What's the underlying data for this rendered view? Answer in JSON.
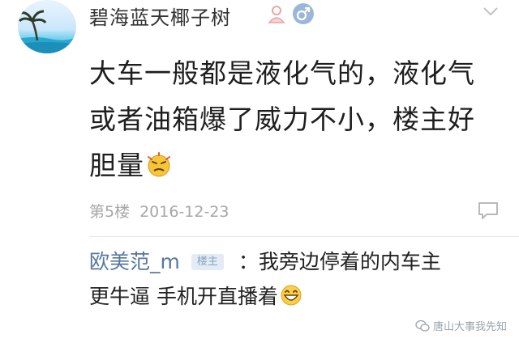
{
  "post": {
    "username": "碧海蓝天椰子树",
    "content_line1": "大车一般都是液化气的，液化气",
    "content_line2": "或者油箱爆了威力不小，楼主好",
    "content_line3": "胆量",
    "floor": "第5楼",
    "date": "2016-12-23"
  },
  "reply": {
    "name": "欧美范_m",
    "badge": "楼主",
    "text_line1": "：我旁边停着的内车主",
    "text_line2": "更牛逼 手机开直播着"
  },
  "watermark": {
    "text": "唐山大事我先知"
  },
  "icons": {
    "avatar": "beach-palm-avatar",
    "level": "user-level-icon",
    "gender": "male-icon",
    "more": "chevron-down-icon",
    "reply": "comment-bubble-icon",
    "emoji1": "angry-face-emoji",
    "emoji2": "grinning-face-emoji",
    "watermark_icon": "wechat-icon"
  },
  "colors": {
    "name": "#333333",
    "reply_name": "#57789e",
    "meta": "#a7a7a7",
    "badge_bg": "#e3ebf5"
  }
}
